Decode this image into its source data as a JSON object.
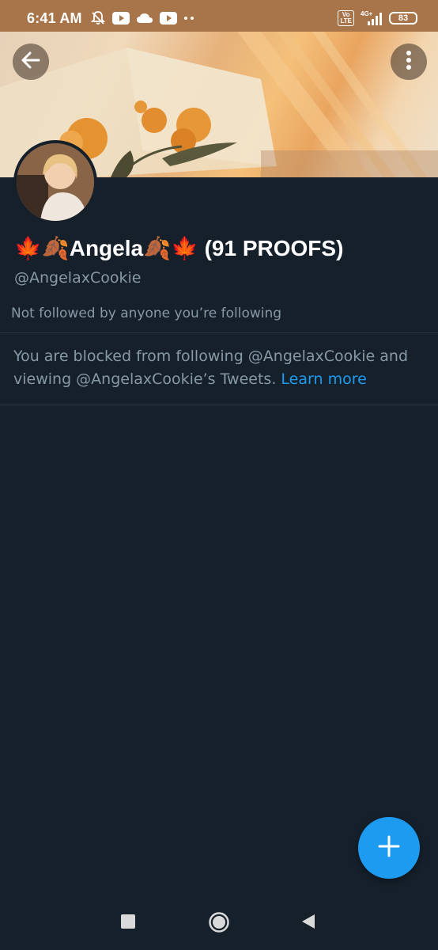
{
  "status_bar": {
    "time": "6:41 AM",
    "volte": "Vo\nLTE",
    "network": "4G+",
    "battery": "83"
  },
  "profile": {
    "display_name": "🍁🍂Angela🍂🍁 (91 PROOFS)",
    "handle": "@AngelaxCookie",
    "followers_note": "Not followed by anyone you’re following",
    "blocked_message": "You are blocked from following @AngelaxCookie and viewing @AngelaxCookie’s Tweets.",
    "learn_more": "Learn more"
  },
  "colors": {
    "background": "#15202b",
    "accent": "#1d9bf0",
    "secondary_text": "#8899a6",
    "status_bar": "#a8744a"
  },
  "icons": {
    "back": "back-arrow-icon",
    "more": "more-vertical-icon",
    "compose": "plus-icon",
    "nav_recents": "square-icon",
    "nav_home": "circle-icon",
    "nav_back": "triangle-back-icon"
  }
}
